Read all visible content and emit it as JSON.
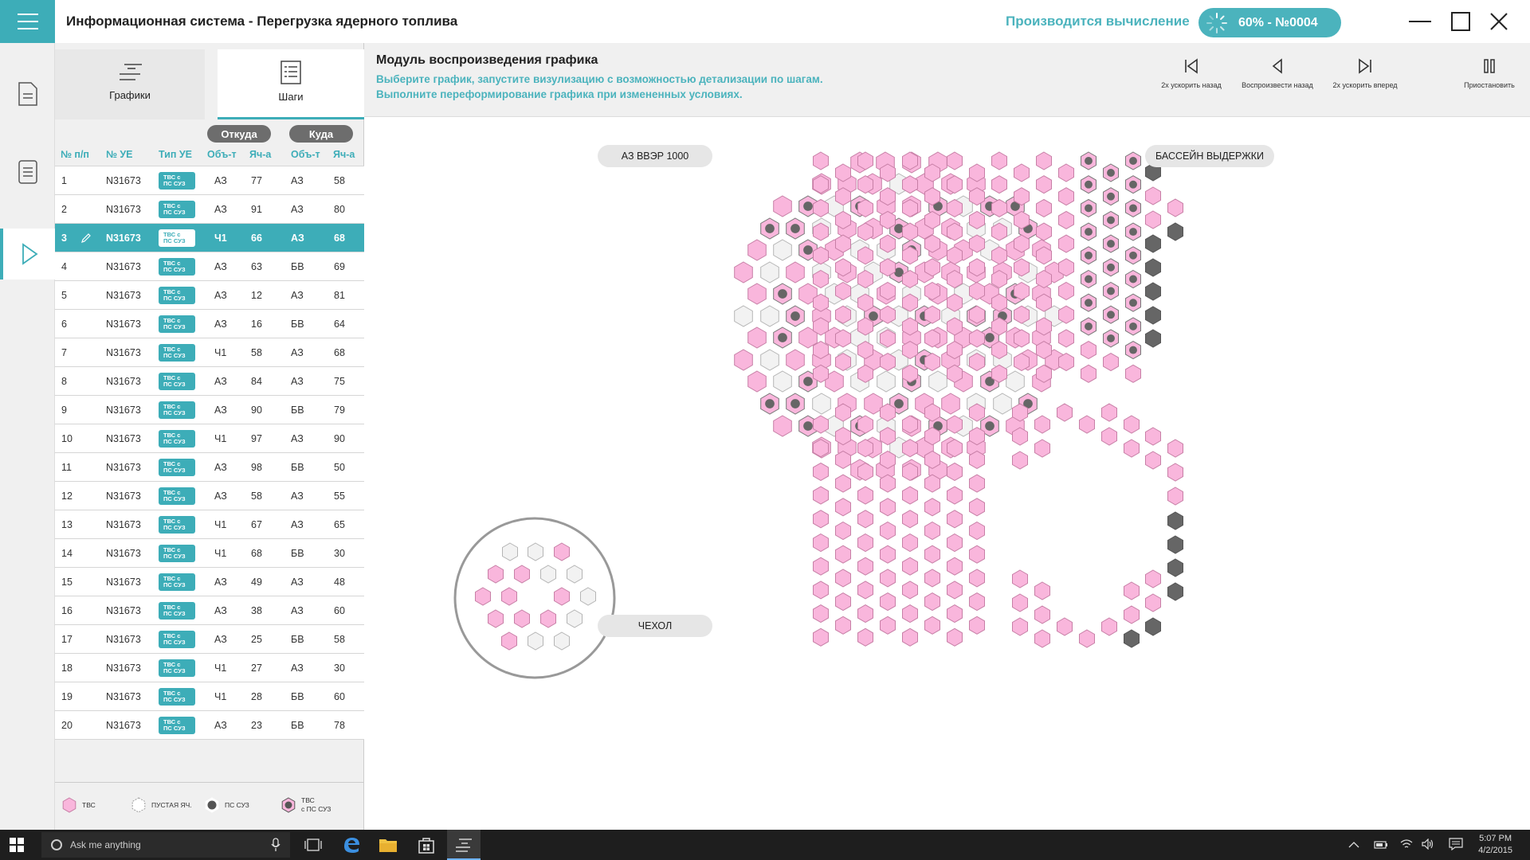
{
  "titlebar": {
    "title": "Информационная система - Перегрузка ядерного топлива",
    "calc_label": "Производится вычисление",
    "calc_badge": "60% - №0004"
  },
  "tabs": {
    "graphs": "Графики",
    "steps": "Шаги"
  },
  "table": {
    "group_from": "Откуда",
    "group_to": "Куда",
    "headers": [
      "№ п/п",
      "№ УЕ",
      "Тип УЕ",
      "Объ-т",
      "Яч-а",
      "Объ-т",
      "Яч-а"
    ],
    "type_label_line1": "ТВС с",
    "type_label_line2": "ПС СУЗ",
    "selected_row": 2,
    "rows": [
      [
        "1",
        "N31673",
        "АЗ",
        "77",
        "АЗ",
        "58"
      ],
      [
        "2",
        "N31673",
        "АЗ",
        "91",
        "АЗ",
        "80"
      ],
      [
        "3",
        "N31673",
        "Ч1",
        "66",
        "АЗ",
        "68"
      ],
      [
        "4",
        "N31673",
        "АЗ",
        "63",
        "БВ",
        "69"
      ],
      [
        "5",
        "N31673",
        "АЗ",
        "12",
        "АЗ",
        "81"
      ],
      [
        "6",
        "N31673",
        "АЗ",
        "16",
        "БВ",
        "64"
      ],
      [
        "7",
        "N31673",
        "Ч1",
        "58",
        "АЗ",
        "68"
      ],
      [
        "8",
        "N31673",
        "АЗ",
        "84",
        "АЗ",
        "75"
      ],
      [
        "9",
        "N31673",
        "АЗ",
        "90",
        "БВ",
        "79"
      ],
      [
        "10",
        "N31673",
        "Ч1",
        "97",
        "АЗ",
        "90"
      ],
      [
        "11",
        "N31673",
        "АЗ",
        "98",
        "БВ",
        "50"
      ],
      [
        "12",
        "N31673",
        "АЗ",
        "58",
        "АЗ",
        "55"
      ],
      [
        "13",
        "N31673",
        "Ч1",
        "67",
        "АЗ",
        "65"
      ],
      [
        "14",
        "N31673",
        "Ч1",
        "68",
        "БВ",
        "30"
      ],
      [
        "15",
        "N31673",
        "АЗ",
        "49",
        "АЗ",
        "48"
      ],
      [
        "16",
        "N31673",
        "АЗ",
        "38",
        "АЗ",
        "60"
      ],
      [
        "17",
        "N31673",
        "АЗ",
        "25",
        "БВ",
        "58"
      ],
      [
        "18",
        "N31673",
        "Ч1",
        "27",
        "АЗ",
        "30"
      ],
      [
        "19",
        "N31673",
        "Ч1",
        "28",
        "БВ",
        "60"
      ],
      [
        "20",
        "N31673",
        "АЗ",
        "23",
        "БВ",
        "78"
      ]
    ]
  },
  "legend": {
    "tvs": "ТВС",
    "empty": "ПУСТАЯ ЯЧ.",
    "pssuz": "ПС СУЗ",
    "tvs_pssuz_line1": "ТВС",
    "tvs_pssuz_line2": "с ПС СУЗ"
  },
  "module": {
    "title": "Модуль воспроизведения графика",
    "desc1": "Выберите график, запустите визулизацию с возможностью детализации по шагам.",
    "desc2": "Выполните переформирование графика при измененных условиях."
  },
  "controls": {
    "fast_back": "2х ускорить назад",
    "play_back": "Воспроизвести назад",
    "fast_fwd": "2х ускорить вперед",
    "pause": "Приостановить"
  },
  "panels": {
    "core": "АЗ  ВВЭР 1000",
    "pool": "БАССЕЙН ВЫДЕРЖКИ",
    "case": "ЧЕХОЛ"
  },
  "colors": {
    "accent": "#3dadb8",
    "tvs_fill": "#f9b6dc",
    "tvs_stroke": "#c77fa6",
    "empty_fill": "#f2f2f2",
    "empty_stroke": "#b5b5b5",
    "rod": "#666666"
  },
  "taskbar": {
    "search": "Ask me anything",
    "time": "5:07 PM",
    "date": "4/2/2015"
  }
}
